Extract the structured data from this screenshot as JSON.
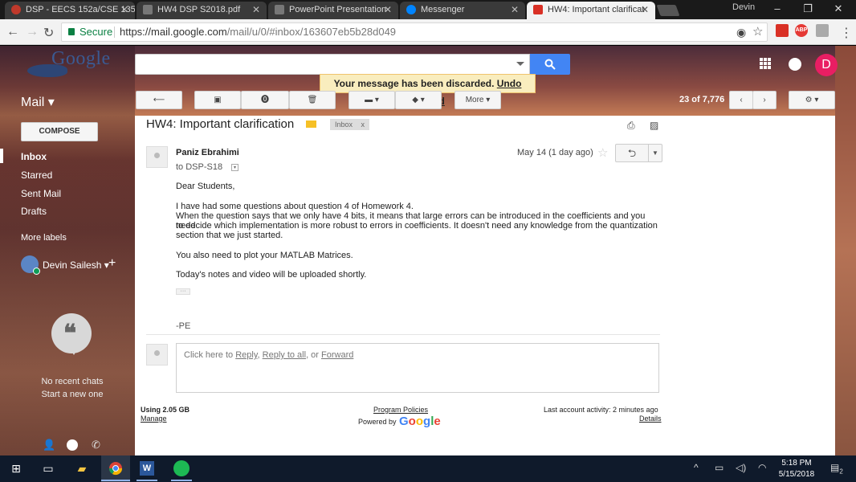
{
  "browser": {
    "tabs": [
      {
        "label": "DSP - EECS 152a/CSE 135",
        "active": false,
        "color": "#c0392b"
      },
      {
        "label": "HW4 DSP S2018.pdf",
        "active": false,
        "color": "#777777"
      },
      {
        "label": "PowerPoint Presentation",
        "active": false,
        "color": "#777777"
      },
      {
        "label": "Messenger",
        "active": false,
        "color": "#0084ff"
      },
      {
        "label": "HW4: Important clarificat",
        "active": true,
        "color": "#d93025"
      }
    ],
    "profile_name": "Devin",
    "security_label": "Secure",
    "url_host": "https://mail.google.com",
    "url_path": "/mail/u/0/#inbox/163607eb5b28d049",
    "extensions": [
      "ABP"
    ]
  },
  "gmail": {
    "logo_text": "Google",
    "mail_label": "Mail ▾",
    "account_initial": "D",
    "toast": {
      "message": "Your message has been discarded.",
      "action": "Undo discard"
    },
    "toolbar": {
      "more_label": "More ▾",
      "count": "23 of 7,776"
    },
    "compose_label": "COMPOSE",
    "nav": {
      "inbox": "Inbox",
      "starred": "Starred",
      "sent": "Sent Mail",
      "drafts": "Drafts",
      "more_labels": "More labels"
    },
    "user_name": "Devin Sailesh ▾",
    "hangouts": {
      "no_chats": "No recent chats",
      "start_new": "Start a new one"
    }
  },
  "message": {
    "subject": "HW4: Important clarification",
    "label_chip": "Inbox",
    "label_chip_close": "x",
    "sender": "Paniz Ebrahimi",
    "to": "to DSP-S18",
    "date": "May 14 (1 day ago)",
    "greeting": "Dear Students,",
    "para1_line1": "I have had some questions about question 4 of Homework 4.",
    "para1_line2": "When the question says that we only have 4 bits, it means that large errors can be introduced in the coefficients and you need",
    "para1_line3": "to decide which implementation is more robust to errors in coefficients. It doesn't need any knowledge from the quantization",
    "para1_line4": "section that we just started.",
    "para2": "You also need to plot your MATLAB Matrices.",
    "para3": "Today's notes and video will be uploaded shortly.",
    "ellipsis": "···",
    "signature": "-PE"
  },
  "reply_box": {
    "prefix": "Click here to ",
    "reply": "Reply",
    "sep1": ", ",
    "reply_all": "Reply to all",
    "sep2": ", or ",
    "forward": "Forward"
  },
  "footer": {
    "storage": "Using 2.05 GB",
    "manage": "Manage",
    "policies": "Program Policies",
    "powered_by": "Powered by",
    "last_activity": "Last account activity: 2 minutes ago",
    "details": "Details"
  },
  "taskbar": {
    "time": "5:18 PM",
    "date": "5/15/2018",
    "notifications": "2"
  },
  "colors": {
    "search_button": "#4285f4",
    "toast_bg": "#f9edbe",
    "account_avatar": "#e91e63",
    "label_tag": "#f6c026"
  }
}
